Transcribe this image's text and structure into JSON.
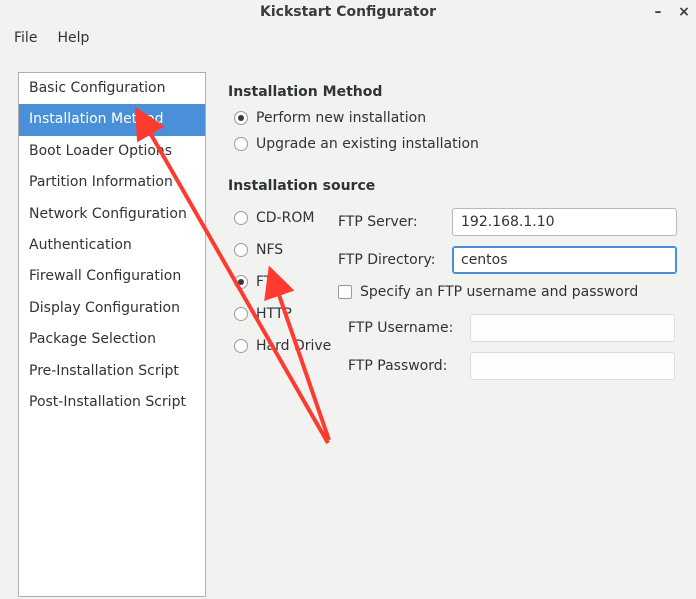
{
  "window": {
    "title": "Kickstart Configurator"
  },
  "menubar": {
    "file": "File",
    "help": "Help"
  },
  "sidebar": {
    "items": [
      "Basic Configuration",
      "Installation Method",
      "Boot Loader Options",
      "Partition Information",
      "Network Configuration",
      "Authentication",
      "Firewall Configuration",
      "Display Configuration",
      "Package Selection",
      "Pre-Installation Script",
      "Post-Installation Script"
    ],
    "selected_index": 1
  },
  "main": {
    "installation_method": {
      "heading": "Installation Method",
      "options": {
        "perform_new": "Perform new installation",
        "upgrade": "Upgrade an existing installation"
      },
      "selected": "perform_new"
    },
    "installation_source": {
      "heading": "Installation source",
      "options": {
        "cdrom": "CD-ROM",
        "nfs": "NFS",
        "ftp": "FTP",
        "http": "HTTP",
        "harddrive": "Hard Drive"
      },
      "selected": "ftp",
      "ftp_server_label": "FTP Server:",
      "ftp_server_value": "192.168.1.10",
      "ftp_directory_label": "FTP Directory:",
      "ftp_directory_value": "centos",
      "specify_creds_label": "Specify an FTP username and password",
      "specify_creds_checked": false,
      "ftp_username_label": "FTP Username:",
      "ftp_username_value": "",
      "ftp_password_label": "FTP Password:",
      "ftp_password_value": ""
    }
  }
}
